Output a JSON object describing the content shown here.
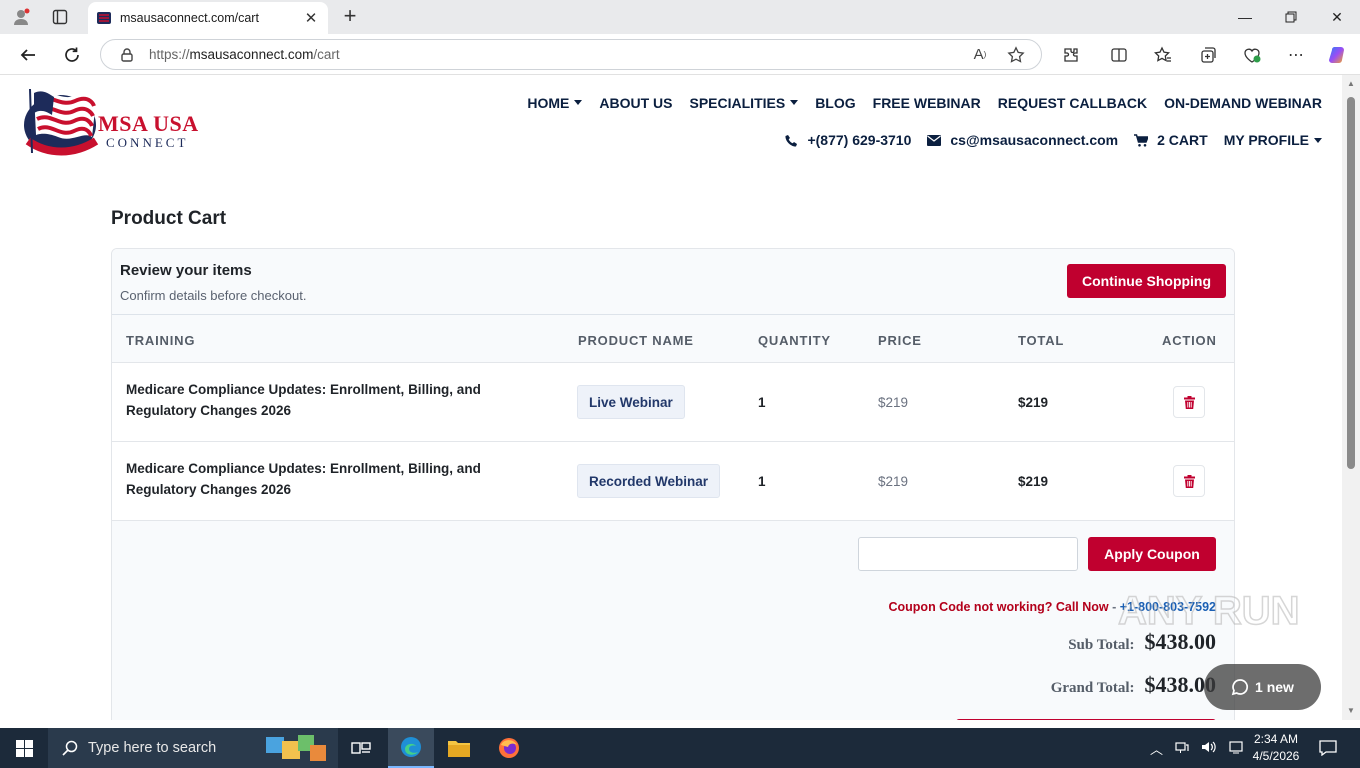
{
  "browser": {
    "tab_title": "msausaconnect.com/cart",
    "url_scheme": "https://",
    "url_host": "msausaconnect.com",
    "url_path": "/cart"
  },
  "site": {
    "brand": "MSA USA",
    "brand_sub": "CONNECT",
    "logo_ring_text": "SINCE 2025",
    "nav": [
      "HOME",
      "ABOUT US",
      "SPECIALITIES",
      "BLOG",
      "FREE WEBINAR",
      "REQUEST CALLBACK",
      "ON-DEMAND WEBINAR"
    ],
    "phone": "+(877) 629-3710",
    "email": "cs@msausaconnect.com",
    "cart": "2 CART",
    "profile": "MY PROFILE"
  },
  "cart": {
    "page_title": "Product Cart",
    "review_title": "Review your items",
    "review_subtitle": "Confirm details before checkout.",
    "continue_label": "Continue Shopping",
    "columns": [
      "TRAINING",
      "PRODUCT NAME",
      "QUANTITY",
      "PRICE",
      "TOTAL",
      "ACTION"
    ],
    "rows": [
      {
        "training": "Medicare Compliance Updates: Enrollment, Billing, and Regulatory Changes 2026",
        "product": "Live Webinar",
        "qty": "1",
        "price": "$219",
        "total": "$219"
      },
      {
        "training": "Medicare Compliance Updates: Enrollment, Billing, and Regulatory Changes 2026",
        "product": "Recorded Webinar",
        "qty": "1",
        "price": "$219",
        "total": "$219"
      }
    ],
    "coupon_placeholder": "",
    "apply_label": "Apply Coupon",
    "coupon_question": "Coupon Code not working? Call Now",
    "coupon_dash": " - ",
    "coupon_phone": "+1-800-803-7592",
    "subtotal_label": "Sub Total:",
    "subtotal_value": "$438.00",
    "grand_label": "Grand Total:",
    "grand_value": "$438.00"
  },
  "overlay": {
    "watermark": "ANY RUN",
    "new_badge": "1 new"
  },
  "taskbar": {
    "search_placeholder": "Type here to search",
    "time": "2:34 AM",
    "date": "4/5/2026"
  },
  "colors": {
    "accent_red": "#c0002f",
    "navy": "#0b1f3f",
    "link_blue": "#1a5fb4"
  }
}
